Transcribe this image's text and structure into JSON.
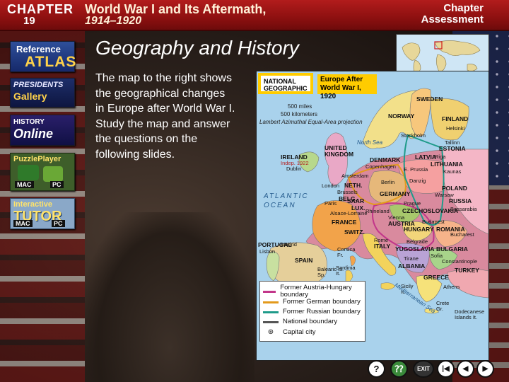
{
  "header": {
    "chapter_label": "CHAPTER",
    "chapter_number": "19",
    "title": "World War I and Its Aftermath,",
    "dates": "1914–1920",
    "assessment_line1": "Chapter",
    "assessment_line2": "Assessment"
  },
  "sidebar": {
    "atlas": {
      "line1": "Reference",
      "line2": "ATLAS"
    },
    "gallery": {
      "line1": "PRESIDENTS",
      "line2": "Gallery"
    },
    "history": {
      "line1": "HISTORY",
      "line2": "Online"
    },
    "puzzle": {
      "line1": "PuzzlePlayer",
      "mac": "MAC",
      "pc": "PC"
    },
    "tutor": {
      "line1": "Interactive",
      "line2": "TUTOR",
      "mac": "MAC",
      "pc": "PC"
    }
  },
  "main": {
    "title": "Geography and History",
    "body": "The map to the right shows the geographical changes in Europe after World War I. Study the map and answer the questions on the following slides."
  },
  "map": {
    "logo": "NATIONAL GEOGRAPHIC",
    "title_line1": "Europe After",
    "title_line2": "World War I, 1920",
    "scale_miles": "500 miles",
    "scale_km": "500 kilometers",
    "projection": "Lambert Azimuthal Equal-Area projection",
    "labels": {
      "norway": "NORWAY",
      "sweden": "SWEDEN",
      "finland": "FINLAND",
      "helsinki": "Helsinki",
      "tallinn": "Tallinn",
      "estonia": "ESTONIA",
      "stockholm": "Stockholm",
      "latvia": "LATVIA",
      "riga": "Riga",
      "lithuania": "LITHUANIA",
      "kaunas": "Kaunas",
      "denmark": "DENMARK",
      "copenhagen": "Copenhagen",
      "e_prussia": "E. Prussia",
      "ireland": "IRELAND",
      "indep": "Indep. 1922",
      "dublin": "Dublin",
      "uk": "UNITED KINGDOM",
      "north_sea": "North Sea",
      "amsterdam": "Amsterdam",
      "neth": "NETH.",
      "london": "London",
      "berlin": "Berlin",
      "danzig": "Danzig",
      "poland": "POLAND",
      "warsaw": "Warsaw",
      "brussels": "Brussels",
      "belg": "BELG.",
      "germany": "GERMANY",
      "saar": "SAAR",
      "prague": "Prague",
      "atlantic": "ATLANTIC OCEAN",
      "paris": "Paris",
      "lux": "LUX.",
      "rhineland": "Rhineland",
      "czech": "CZECHOSLOVAKIA",
      "alsace": "Alsace-Lorraine",
      "france": "FRANCE",
      "vienna": "Vienna",
      "austria": "AUSTRIA",
      "budapest": "Budapest",
      "hungary": "HUNGARY",
      "romania": "ROMANIA",
      "russia": "RUSSIA",
      "bessarabia": "Bessarabia",
      "switz": "SWITZ.",
      "bucharest": "Bucharest",
      "rome": "Rome",
      "italy": "ITALY",
      "yugoslavia": "YUGOSLAVIA",
      "belgrade": "Belgrade",
      "bulgaria": "BULGARIA",
      "sofia": "Sofia",
      "portugal": "PORTUGAL",
      "lisbon": "Lisbon",
      "madrid": "Madrid",
      "spain": "SPAIN",
      "corsica": "Corsica Fr.",
      "sardinia": "Sardinia It.",
      "tirane": "Tirane",
      "albania": "ALBANIA",
      "constantinople": "Constantinople",
      "turkey": "TURKEY",
      "balearic": "Balearic Is. Sp.",
      "sicily": "Sicily It.",
      "greece": "GREECE",
      "athens": "Athens",
      "crete": "Crete Gr.",
      "dodecanese": "Dodecanese Islands It.",
      "med": "Mediterranean Sea"
    },
    "legend": [
      {
        "label": "Former Austria-Hungary boundary",
        "color": "#c2368a"
      },
      {
        "label": "Former German boundary",
        "color": "#e39a1c"
      },
      {
        "label": "Former Russian boundary",
        "color": "#1f9b8a"
      },
      {
        "label": "National boundary",
        "color": "#555555"
      },
      {
        "label": "Capital city",
        "color": "#222222"
      }
    ]
  },
  "nav": {
    "help": "?",
    "exit": "EXIT",
    "first": "|◀",
    "prev": "◀",
    "next": "▶",
    "last": "▶|"
  }
}
